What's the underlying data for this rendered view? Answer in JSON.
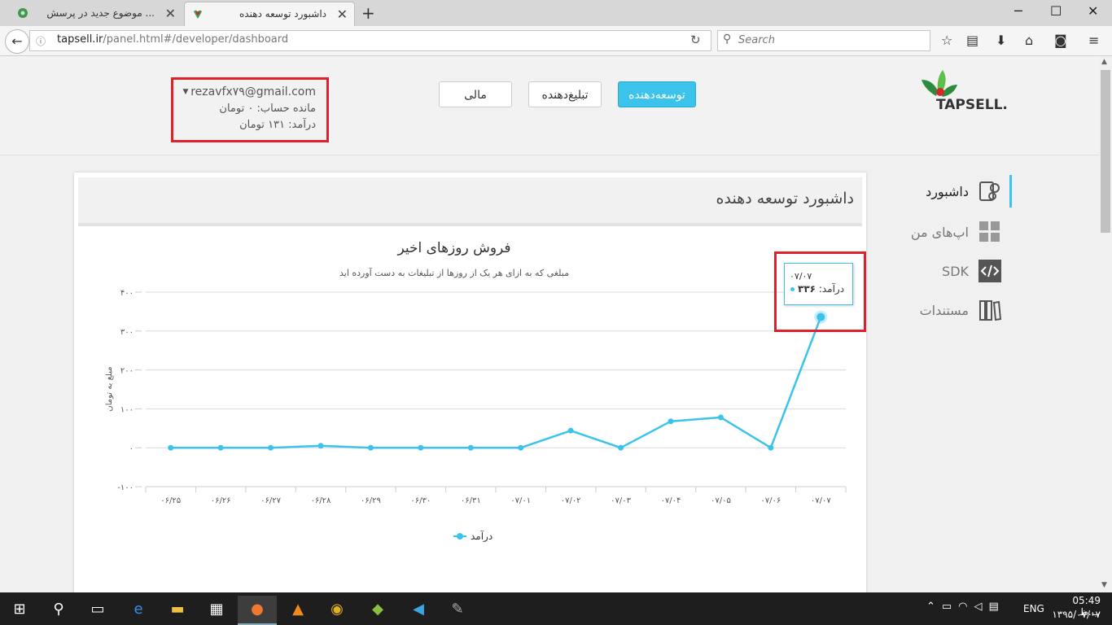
{
  "browser": {
    "tabs": [
      {
        "title": "... موضوع جدید در پرسش",
        "close": "✕"
      },
      {
        "title": "داشبورد توسعه دهنده",
        "close": "✕"
      }
    ],
    "new_tab": "+",
    "window_buttons": {
      "minimize": "─",
      "maximize": "☐",
      "close": "✕"
    },
    "url_domain": "tapsell.ir",
    "url_path": "/panel.html#/developer/dashboard",
    "search_placeholder": "Search"
  },
  "header": {
    "logo_text": "TAPSELL.",
    "nav_buttons": {
      "developer": "توسعه‌دهنده",
      "advertiser": "تبلیغ‌دهنده",
      "finance": "مالی"
    },
    "user": {
      "email": "rezavfx۷۹@gmail.com",
      "balance": "مانده حساب: ۰ تومان",
      "income": "درآمد: ۱۳۱ تومان"
    }
  },
  "sidebar": {
    "items": [
      {
        "label": "داشبورد",
        "icon": "dashboard-icon",
        "active": true
      },
      {
        "label": "اپ‌های من",
        "icon": "apps-grid-icon"
      },
      {
        "label": "SDK",
        "icon": "code-icon"
      },
      {
        "label": "مستندات",
        "icon": "docs-binder-icon"
      }
    ]
  },
  "card": {
    "title": "داشبورد توسعه دهنده"
  },
  "chart_data": {
    "type": "line",
    "title": "فروش روزهای اخیر",
    "subtitle": "مبلغی که به ازای هر یک از روزها از تبلیغات به دست آورده اید",
    "ylabel": "مبلغ به تومان",
    "xlabel": "",
    "categories": [
      "۰۶/۲۵",
      "۰۶/۲۶",
      "۰۶/۲۷",
      "۰۶/۲۸",
      "۰۶/۲۹",
      "۰۶/۳۰",
      "۰۶/۳۱",
      "۰۷/۰۱",
      "۰۷/۰۲",
      "۰۷/۰۳",
      "۰۷/۰۴",
      "۰۷/۰۵",
      "۰۷/۰۶",
      "۰۷/۰۷"
    ],
    "y_ticks": [
      "۴۰۰",
      "۳۰۰",
      "۲۰۰",
      "۱۰۰",
      "۰",
      "-۱۰۰"
    ],
    "ylim": [
      -100,
      400
    ],
    "series": [
      {
        "name": "درآمد",
        "color": "#3bc3ec",
        "values": [
          0,
          0,
          0,
          5,
          0,
          0,
          0,
          0,
          44,
          0,
          68,
          78,
          0,
          336
        ]
      }
    ],
    "grid": true,
    "legend": "bottom-center",
    "tooltip": {
      "date": "۰۷/۰۷",
      "label": "درآمد:",
      "value": "۳۳۶"
    }
  },
  "taskbar": {
    "language": "ENG",
    "time": "05:49 ب.ظ",
    "date": "۱۳۹۵/۰۷/۰۷"
  }
}
